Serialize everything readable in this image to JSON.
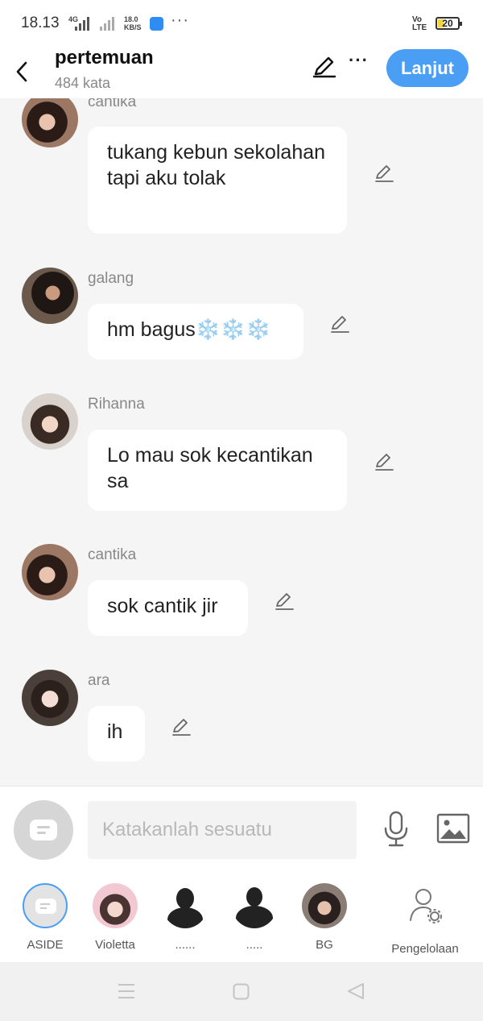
{
  "status_bar": {
    "time": "18.13",
    "network_speed_top": "18.0",
    "network_speed_bottom": "KB/S",
    "network_type": "4G",
    "volte_top": "Vo",
    "volte_bottom": "LTE",
    "battery": "20"
  },
  "header": {
    "title": "pertemuan",
    "word_count": "484 kata",
    "next_label": "Lanjut",
    "more_label": "···"
  },
  "messages": [
    {
      "sender": "cantika",
      "text": "tukang kebun sekolahan tapi aku tolak"
    },
    {
      "sender": "galang",
      "text": "hm bagus❄️❄️❄️"
    },
    {
      "sender": "Rihanna",
      "text": "Lo mau sok kecantikan sa"
    },
    {
      "sender": "cantika",
      "text": "sok cantik jir"
    },
    {
      "sender": "ara",
      "text": "ih"
    }
  ],
  "composer": {
    "placeholder": "Katakanlah sesuatu"
  },
  "characters": [
    {
      "label": "ASIDE"
    },
    {
      "label": "Violetta"
    },
    {
      "label": "......"
    },
    {
      "label": "....."
    },
    {
      "label": "BG"
    },
    {
      "label": "Pengelolaan"
    }
  ],
  "colors": {
    "accent": "#4a9ef3",
    "background": "#f5f5f5",
    "bubble": "#ffffff"
  }
}
